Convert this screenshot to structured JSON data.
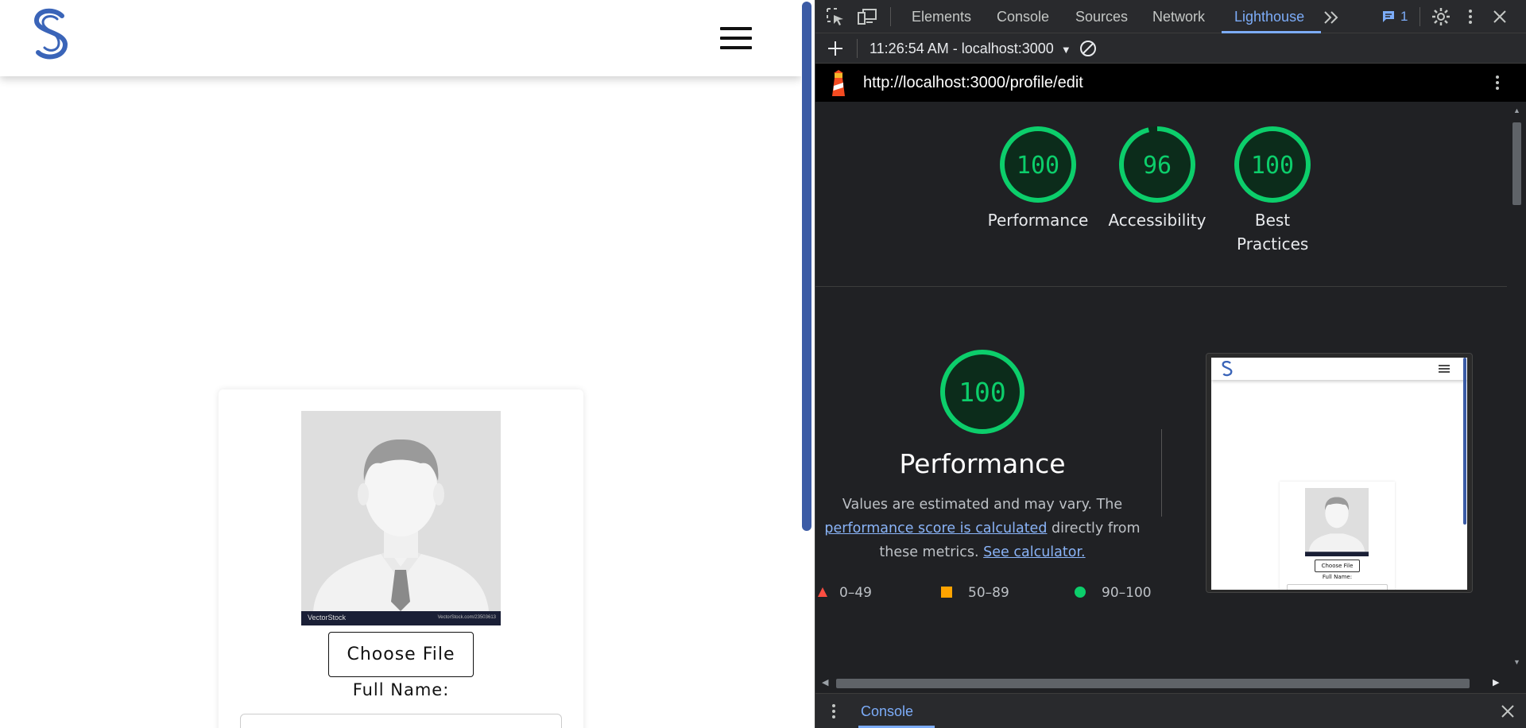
{
  "page": {
    "choose_file_label": "Choose File",
    "full_name_label": "Full Name:",
    "avatar_watermark_left": "VectorStock",
    "avatar_watermark_right": "VectorStock.com/23503613"
  },
  "devtools": {
    "tabs": [
      {
        "label": "Elements",
        "active": false
      },
      {
        "label": "Console",
        "active": false
      },
      {
        "label": "Sources",
        "active": false
      },
      {
        "label": "Network",
        "active": false
      },
      {
        "label": "Lighthouse",
        "active": true
      }
    ],
    "more_tabs_icon": "chevron-double-right-icon",
    "issues_count": "1",
    "report_select": "11:26:54 AM - localhost:3000",
    "url": "http://localhost:3000/profile/edit",
    "drawer_tab": "Console"
  },
  "lighthouse": {
    "gauges": [
      {
        "label": "Performance",
        "score": 100
      },
      {
        "label": "Accessibility",
        "score": 96
      },
      {
        "label": "Best Practices",
        "score": 100
      }
    ],
    "performance_score": 100,
    "performance_title": "Performance",
    "desc_prefix": "Values are estimated and may vary. The",
    "desc_link1": "performance score is calculated",
    "desc_mid": "directly from these metrics.",
    "desc_link2": "See calculator.",
    "legend": [
      {
        "range": "0–49",
        "shape": "triangle",
        "color": "#ff4e42"
      },
      {
        "range": "50–89",
        "shape": "square",
        "color": "#ffa400"
      },
      {
        "range": "90–100",
        "shape": "circle",
        "color": "#0cce6b"
      }
    ],
    "thumbnail": {
      "choose_file_label": "Choose File",
      "full_name_label": "Full Name:"
    },
    "colors": {
      "pass": "#0cce6b",
      "pass_bg": "#0c2c1b"
    }
  }
}
